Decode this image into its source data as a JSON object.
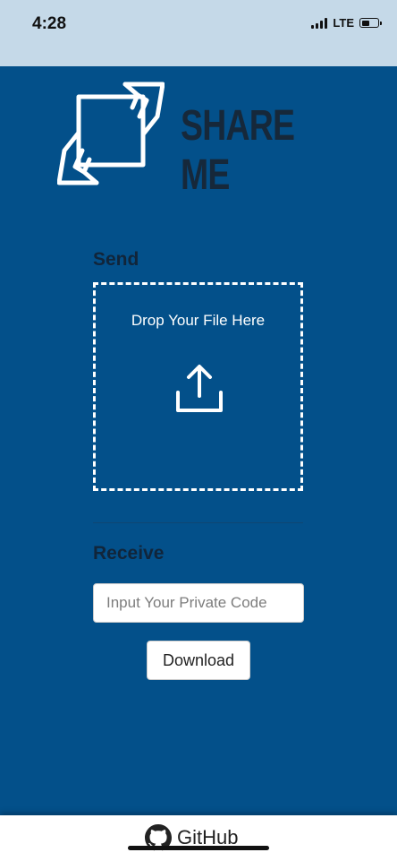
{
  "status_bar": {
    "time": "4:28",
    "network": "LTE"
  },
  "brand": {
    "title": "SHARE ME",
    "logo_icon": "hands-exchange-icon"
  },
  "send": {
    "heading": "Send",
    "drop_text": "Drop Your File Here",
    "upload_icon": "upload-icon"
  },
  "receive": {
    "heading": "Receive",
    "input_placeholder": "Input Your Private Code",
    "input_value": "",
    "download_label": "Download"
  },
  "footer": {
    "link_label": "GitHub",
    "icon": "github-icon"
  },
  "colors": {
    "background": "#03508a",
    "status_bar": "#c5d9e8",
    "heading": "#11253a",
    "white": "#ffffff"
  }
}
